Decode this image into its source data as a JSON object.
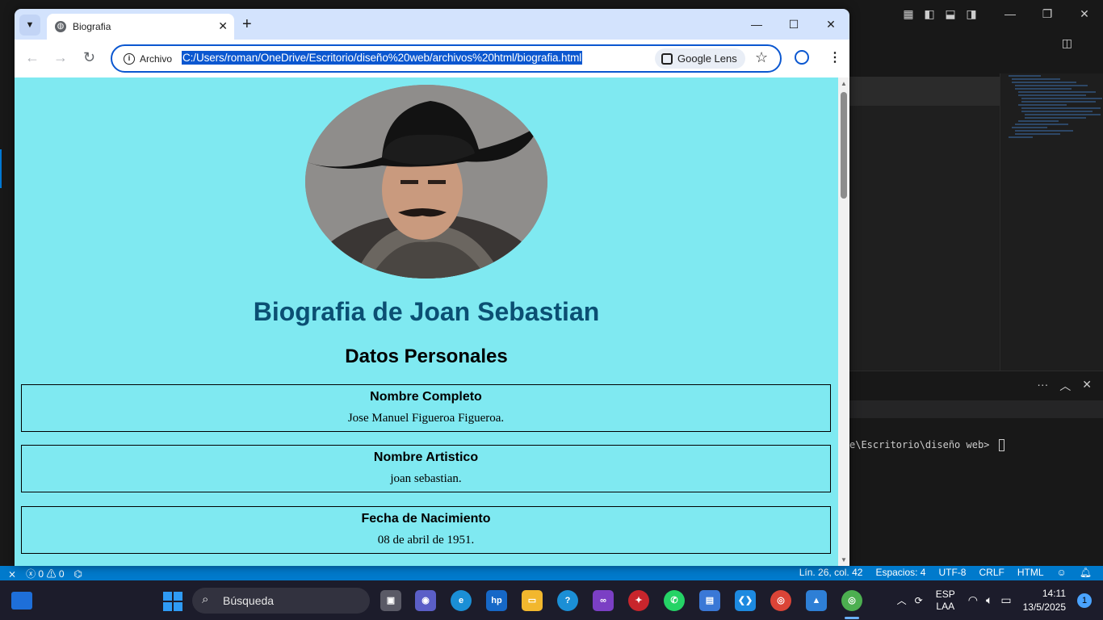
{
  "browser": {
    "tab_title": "Biografia",
    "site_label": "Archivo",
    "url": "C:/Users/roman/OneDrive/Escritorio/diseño%20web/archivos%20html/biografia.html",
    "lens_label": "Google Lens"
  },
  "page": {
    "title": "Biografia de Joan Sebastian",
    "subtitle": "Datos Personales",
    "cards": [
      {
        "heading": "Nombre Completo",
        "value": "Jose Manuel Figueroa Figueroa."
      },
      {
        "heading": "Nombre Artistico",
        "value": "joan sebastian."
      },
      {
        "heading": "Fecha de Nacimiento",
        "value": "08 de abril de 1951."
      }
    ]
  },
  "vscode": {
    "terminal_line": "e\\Escritorio\\diseño web> ",
    "status": {
      "errors": "0",
      "warnings": "0",
      "position": "Lín. 26, col. 42",
      "spaces": "Espacios: 4",
      "encoding": "UTF-8",
      "eol": "CRLF",
      "language": "HTML"
    }
  },
  "taskbar": {
    "search_placeholder": "Búsqueda",
    "lang_top": "ESP",
    "lang_bottom": "LAA",
    "time": "14:11",
    "date": "13/5/2025",
    "notification_count": "1"
  },
  "colors": {
    "page_bg": "#7fe9f1",
    "title_color": "#0b4f73",
    "accent": "#0b57d0",
    "statusbar": "#007acc"
  }
}
